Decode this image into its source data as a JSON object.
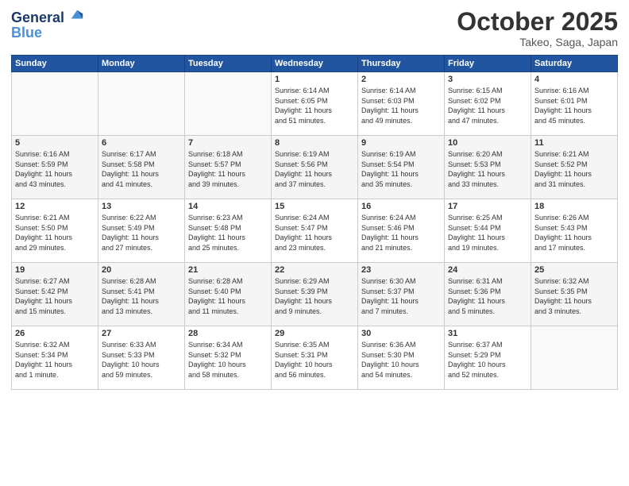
{
  "header": {
    "logo_line1": "General",
    "logo_line2": "Blue",
    "title": "October 2025",
    "subtitle": "Takeo, Saga, Japan"
  },
  "weekdays": [
    "Sunday",
    "Monday",
    "Tuesday",
    "Wednesday",
    "Thursday",
    "Friday",
    "Saturday"
  ],
  "weeks": [
    [
      {
        "day": "",
        "text": ""
      },
      {
        "day": "",
        "text": ""
      },
      {
        "day": "",
        "text": ""
      },
      {
        "day": "1",
        "text": "Sunrise: 6:14 AM\nSunset: 6:05 PM\nDaylight: 11 hours\nand 51 minutes."
      },
      {
        "day": "2",
        "text": "Sunrise: 6:14 AM\nSunset: 6:03 PM\nDaylight: 11 hours\nand 49 minutes."
      },
      {
        "day": "3",
        "text": "Sunrise: 6:15 AM\nSunset: 6:02 PM\nDaylight: 11 hours\nand 47 minutes."
      },
      {
        "day": "4",
        "text": "Sunrise: 6:16 AM\nSunset: 6:01 PM\nDaylight: 11 hours\nand 45 minutes."
      }
    ],
    [
      {
        "day": "5",
        "text": "Sunrise: 6:16 AM\nSunset: 5:59 PM\nDaylight: 11 hours\nand 43 minutes."
      },
      {
        "day": "6",
        "text": "Sunrise: 6:17 AM\nSunset: 5:58 PM\nDaylight: 11 hours\nand 41 minutes."
      },
      {
        "day": "7",
        "text": "Sunrise: 6:18 AM\nSunset: 5:57 PM\nDaylight: 11 hours\nand 39 minutes."
      },
      {
        "day": "8",
        "text": "Sunrise: 6:19 AM\nSunset: 5:56 PM\nDaylight: 11 hours\nand 37 minutes."
      },
      {
        "day": "9",
        "text": "Sunrise: 6:19 AM\nSunset: 5:54 PM\nDaylight: 11 hours\nand 35 minutes."
      },
      {
        "day": "10",
        "text": "Sunrise: 6:20 AM\nSunset: 5:53 PM\nDaylight: 11 hours\nand 33 minutes."
      },
      {
        "day": "11",
        "text": "Sunrise: 6:21 AM\nSunset: 5:52 PM\nDaylight: 11 hours\nand 31 minutes."
      }
    ],
    [
      {
        "day": "12",
        "text": "Sunrise: 6:21 AM\nSunset: 5:50 PM\nDaylight: 11 hours\nand 29 minutes."
      },
      {
        "day": "13",
        "text": "Sunrise: 6:22 AM\nSunset: 5:49 PM\nDaylight: 11 hours\nand 27 minutes."
      },
      {
        "day": "14",
        "text": "Sunrise: 6:23 AM\nSunset: 5:48 PM\nDaylight: 11 hours\nand 25 minutes."
      },
      {
        "day": "15",
        "text": "Sunrise: 6:24 AM\nSunset: 5:47 PM\nDaylight: 11 hours\nand 23 minutes."
      },
      {
        "day": "16",
        "text": "Sunrise: 6:24 AM\nSunset: 5:46 PM\nDaylight: 11 hours\nand 21 minutes."
      },
      {
        "day": "17",
        "text": "Sunrise: 6:25 AM\nSunset: 5:44 PM\nDaylight: 11 hours\nand 19 minutes."
      },
      {
        "day": "18",
        "text": "Sunrise: 6:26 AM\nSunset: 5:43 PM\nDaylight: 11 hours\nand 17 minutes."
      }
    ],
    [
      {
        "day": "19",
        "text": "Sunrise: 6:27 AM\nSunset: 5:42 PM\nDaylight: 11 hours\nand 15 minutes."
      },
      {
        "day": "20",
        "text": "Sunrise: 6:28 AM\nSunset: 5:41 PM\nDaylight: 11 hours\nand 13 minutes."
      },
      {
        "day": "21",
        "text": "Sunrise: 6:28 AM\nSunset: 5:40 PM\nDaylight: 11 hours\nand 11 minutes."
      },
      {
        "day": "22",
        "text": "Sunrise: 6:29 AM\nSunset: 5:39 PM\nDaylight: 11 hours\nand 9 minutes."
      },
      {
        "day": "23",
        "text": "Sunrise: 6:30 AM\nSunset: 5:37 PM\nDaylight: 11 hours\nand 7 minutes."
      },
      {
        "day": "24",
        "text": "Sunrise: 6:31 AM\nSunset: 5:36 PM\nDaylight: 11 hours\nand 5 minutes."
      },
      {
        "day": "25",
        "text": "Sunrise: 6:32 AM\nSunset: 5:35 PM\nDaylight: 11 hours\nand 3 minutes."
      }
    ],
    [
      {
        "day": "26",
        "text": "Sunrise: 6:32 AM\nSunset: 5:34 PM\nDaylight: 11 hours\nand 1 minute."
      },
      {
        "day": "27",
        "text": "Sunrise: 6:33 AM\nSunset: 5:33 PM\nDaylight: 10 hours\nand 59 minutes."
      },
      {
        "day": "28",
        "text": "Sunrise: 6:34 AM\nSunset: 5:32 PM\nDaylight: 10 hours\nand 58 minutes."
      },
      {
        "day": "29",
        "text": "Sunrise: 6:35 AM\nSunset: 5:31 PM\nDaylight: 10 hours\nand 56 minutes."
      },
      {
        "day": "30",
        "text": "Sunrise: 6:36 AM\nSunset: 5:30 PM\nDaylight: 10 hours\nand 54 minutes."
      },
      {
        "day": "31",
        "text": "Sunrise: 6:37 AM\nSunset: 5:29 PM\nDaylight: 10 hours\nand 52 minutes."
      },
      {
        "day": "",
        "text": ""
      }
    ]
  ]
}
